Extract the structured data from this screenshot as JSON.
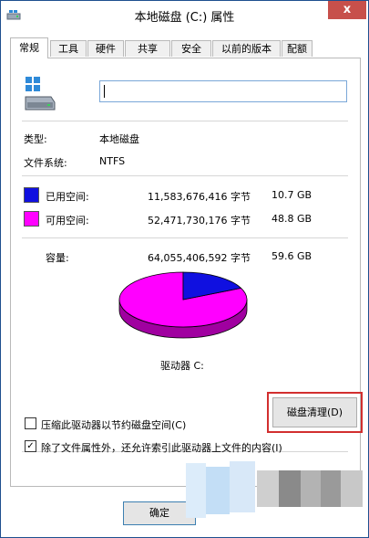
{
  "window": {
    "title": "本地磁盘 (C:) 属性",
    "close_glyph": "x"
  },
  "tabs": [
    {
      "label": "常规",
      "active": true
    },
    {
      "label": "工具",
      "active": false
    },
    {
      "label": "硬件",
      "active": false
    },
    {
      "label": "共享",
      "active": false
    },
    {
      "label": "安全",
      "active": false
    },
    {
      "label": "以前的版本",
      "active": false
    },
    {
      "label": "配额",
      "active": false
    }
  ],
  "general": {
    "volume_name_value": "",
    "type_label": "类型:",
    "type_value": "本地磁盘",
    "fs_label": "文件系统:",
    "fs_value": "NTFS"
  },
  "space": {
    "used": {
      "label": "已用空间:",
      "bytes": "11,583,676,416 字节",
      "gb": "10.7 GB",
      "color": "#1010e0"
    },
    "free": {
      "label": "可用空间:",
      "bytes": "52,471,730,176 字节",
      "gb": "48.8 GB",
      "color": "#ff00ff"
    },
    "capacity": {
      "label": "容量:",
      "bytes": "64,055,406,592 字节",
      "gb": "59.6 GB"
    },
    "used_fraction": 0.181
  },
  "drive_label": "驱动器 C:",
  "cleanup_button": "磁盘清理(D)",
  "options": {
    "compress": {
      "label": "压缩此驱动器以节约磁盘空间(C)",
      "checked": false
    },
    "index": {
      "label": "除了文件属性外，还允许索引此驱动器上文件的内容(I)",
      "checked": true
    }
  },
  "buttons": {
    "ok": "确定"
  },
  "colors": {
    "accent": "#7aa7d8",
    "highlight": "#d22f2f",
    "close": "#c7504b"
  }
}
